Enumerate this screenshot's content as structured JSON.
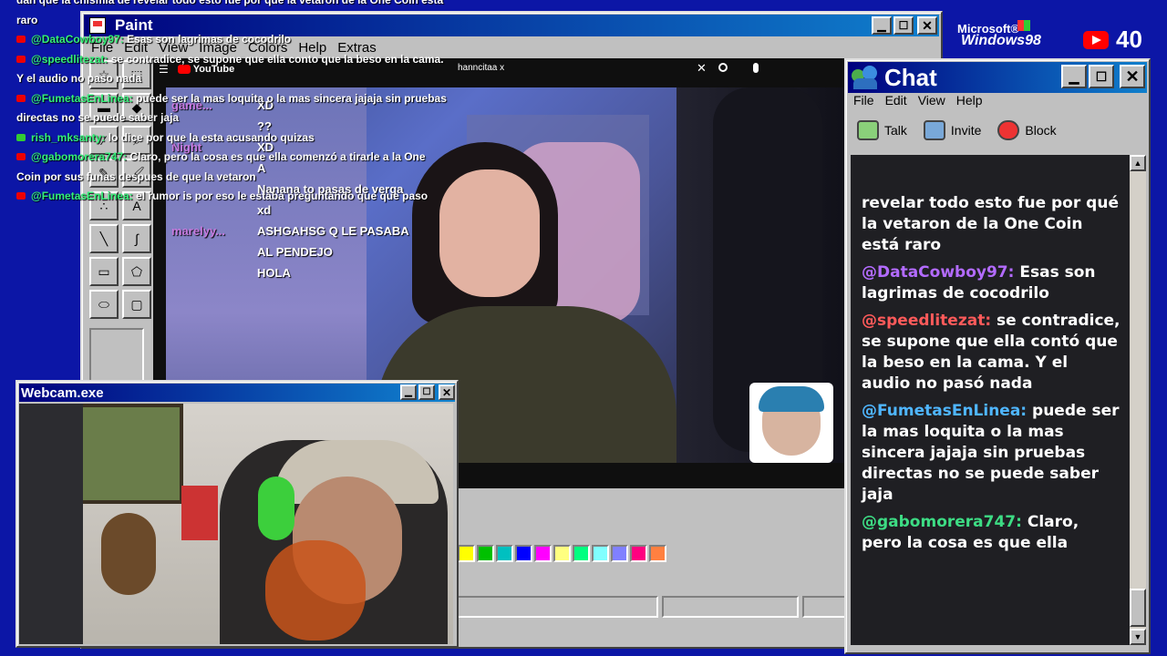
{
  "taskbar": {
    "windows_logo_top": "Microsoft®",
    "windows_logo_main": "Windows98",
    "viewer_count": "40"
  },
  "overlay_chat": {
    "lines": [
      {
        "user": "",
        "text": "dan que la chismia de revelar todo esto fue por que la vetaron de la One Coin esta"
      },
      {
        "user": "",
        "text": "raro"
      },
      {
        "user": "@DataCowboy97:",
        "text": "Esas son lagrimas de cocodrilo"
      },
      {
        "user": "@speedlitezat:",
        "text": "se contradice, se supone que ella conto que la beso en la cama."
      },
      {
        "user": "",
        "text": "Y el audio no paso nada"
      },
      {
        "user": "@FumetasEnLinea:",
        "text": "puede ser la mas loquita o la mas sincera jajaja sin pruebas"
      },
      {
        "user": "",
        "text": "directas no se puede saber jaja"
      },
      {
        "user": "rish_mksanty:",
        "text": "lo dice por que la esta acusando quizas"
      },
      {
        "user": "@gabomorera747:",
        "text": "Claro, pero la cosa es que ella comenzó a tirarle a la One"
      },
      {
        "user": "",
        "text": "Coin por sus funas despues de que la vetaron"
      },
      {
        "user": "@FumetasEnLinea:",
        "text": "el rumor is por eso le estaba preguntando que que paso"
      }
    ]
  },
  "paint": {
    "title": "Paint",
    "menu": [
      "File",
      "Edit",
      "View",
      "Image",
      "Colors",
      "Help",
      "Extras"
    ],
    "palette": [
      "#ffff00",
      "#00c000",
      "#00c0c0",
      "#0000ff",
      "#ff00ff",
      "#ffff80",
      "#00ff80",
      "#80ffff",
      "#8080ff",
      "#ff0080",
      "#ff8040"
    ],
    "tools": [
      "select-star",
      "select-rect",
      "eraser",
      "fill",
      "eyedropper",
      "magnifier",
      "pencil",
      "brush",
      "airbrush",
      "text",
      "line",
      "curve",
      "rectangle",
      "polygon",
      "ellipse",
      "rounded-rect"
    ]
  },
  "youtube": {
    "brand": "YouTube",
    "search_value": "hanncitaa x",
    "stream_chat": [
      {
        "user": "game...",
        "text": "XD"
      },
      {
        "user": "",
        "text": "??"
      },
      {
        "user": "Night",
        "text": "XD"
      },
      {
        "user": "",
        "text": "A"
      },
      {
        "user": "",
        "text": "Nanana to pasas de verga"
      },
      {
        "user": "",
        "text": "xd"
      },
      {
        "user": "marelyy...",
        "text": "ASHGAHSG Q LE PASABA AL PENDEJO"
      },
      {
        "user": "",
        "text": "HOLA"
      }
    ]
  },
  "webcam": {
    "title": "Webcam.exe"
  },
  "chat": {
    "title": "Chat",
    "menu": [
      "File",
      "Edit",
      "View",
      "Help"
    ],
    "toolbar": [
      "Talk",
      "Invite",
      "Block"
    ],
    "messages": [
      {
        "user": "",
        "text": "revelar todo esto fue por qué la vetaron de la One Coin está raro",
        "color": "#ffffff"
      },
      {
        "user": "@DataCowboy97:",
        "text": "Esas son lagrimas de cocodrilo",
        "color": "#b36bff"
      },
      {
        "user": "@speedlitezat:",
        "text": "se contradice, se supone que ella contó que la beso en la cama. Y el audio no pasó nada",
        "color": "#ff5a5a"
      },
      {
        "user": "@FumetasEnLinea:",
        "text": "puede ser la mas loquita o la mas sincera jajaja sin pruebas directas no se puede saber jaja",
        "color": "#4fb6ff"
      },
      {
        "user": "@gabomorera747:",
        "text": "Claro, pero la cosa es que ella",
        "color": "#3ddc84"
      }
    ]
  }
}
